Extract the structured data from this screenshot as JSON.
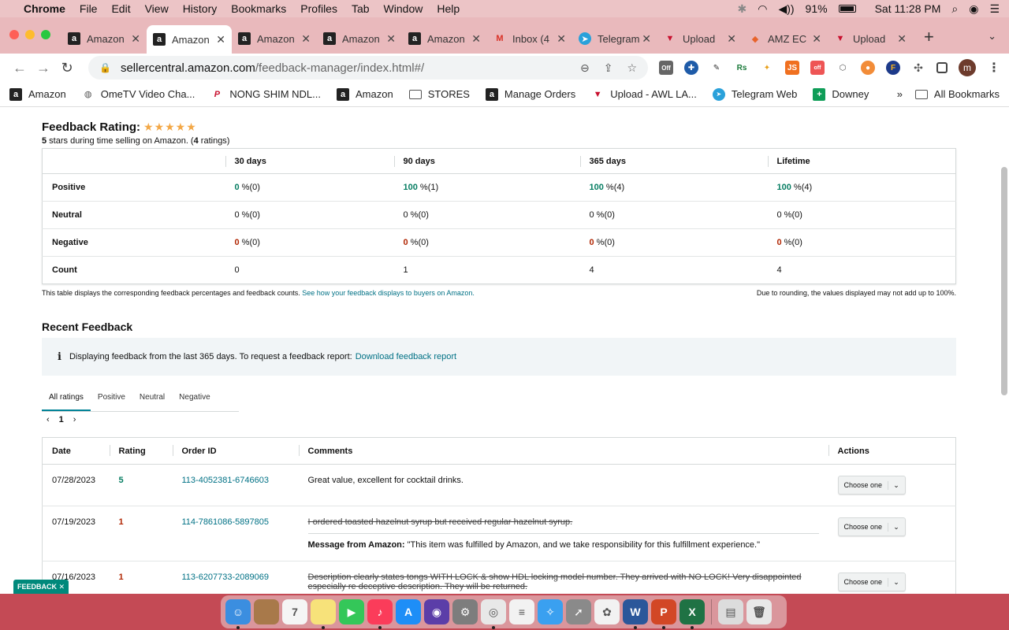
{
  "menubar": {
    "app_name": "Chrome",
    "items": [
      "File",
      "Edit",
      "View",
      "History",
      "Bookmarks",
      "Profiles",
      "Tab",
      "Window",
      "Help"
    ],
    "battery": "91%",
    "clock": "Sat 11:28 PM"
  },
  "tabs": [
    {
      "title": "Amazon",
      "icon": "amazon-icon",
      "active": false
    },
    {
      "title": "Amazon",
      "icon": "amazon-icon",
      "active": true
    },
    {
      "title": "Amazon",
      "icon": "amazon-icon",
      "active": false
    },
    {
      "title": "Amazon",
      "icon": "amazon-icon",
      "active": false
    },
    {
      "title": "Amazon",
      "icon": "amazon-icon",
      "active": false
    },
    {
      "title": "Inbox (4",
      "icon": "gmail-icon",
      "active": false
    },
    {
      "title": "Telegram",
      "icon": "telegram-icon",
      "active": false
    },
    {
      "title": "Upload",
      "icon": "upload-icon",
      "active": false
    },
    {
      "title": "AMZ EC",
      "icon": "amz-ec-icon",
      "active": false
    },
    {
      "title": "Upload",
      "icon": "upload-icon",
      "active": false
    }
  ],
  "omnibox": {
    "host": "sellercentral.amazon.com",
    "path": "/feedback-manager/index.html#/"
  },
  "extensions": {
    "off_badge": "Off",
    "rs": "Rs",
    "js": "JS",
    "off_label": "off",
    "f": "F",
    "avatar_letter": "m"
  },
  "bookmarks": [
    {
      "label": "Amazon",
      "icon": "amazon-icon"
    },
    {
      "label": "OmeTV Video Cha...",
      "icon": "globe-icon"
    },
    {
      "label": "NONG SHIM NDL...",
      "icon": "pinterest-icon"
    },
    {
      "label": "Amazon",
      "icon": "amazon-icon"
    },
    {
      "label": "STORES",
      "icon": "folder-icon"
    },
    {
      "label": "Manage Orders",
      "icon": "amazon-icon"
    },
    {
      "label": "Upload - AWL LA...",
      "icon": "upload-icon"
    },
    {
      "label": "Telegram Web",
      "icon": "telegram-icon"
    },
    {
      "label": "Downey",
      "icon": "sheets-icon"
    }
  ],
  "bookmarks_more": "»",
  "all_bookmarks": "All Bookmarks",
  "feedback_rating": {
    "title": "Feedback Rating:",
    "stars": "★★★★★",
    "stars_count": "5",
    "subtitle_mid": " stars during time selling on Amazon. (",
    "ratings_count": "4",
    "subtitle_end": " ratings)"
  },
  "metrics": {
    "headers": [
      "",
      "30 days",
      "90 days",
      "365 days",
      "Lifetime"
    ],
    "rows": [
      {
        "label": "Positive",
        "cells": [
          {
            "v": "0",
            "s": " %(0)"
          },
          {
            "v": "100",
            "s": " %(1)"
          },
          {
            "v": "100",
            "s": " %(4)"
          },
          {
            "v": "100",
            "s": " %(4)"
          }
        ],
        "cls": "pos"
      },
      {
        "label": "Neutral",
        "cells": [
          {
            "v": "0",
            "s": " %(0)"
          },
          {
            "v": "0",
            "s": " %(0)"
          },
          {
            "v": "0",
            "s": " %(0)"
          },
          {
            "v": "0",
            "s": " %(0)"
          }
        ],
        "cls": ""
      },
      {
        "label": "Negative",
        "cells": [
          {
            "v": "0",
            "s": " %(0)"
          },
          {
            "v": "0",
            "s": " %(0)"
          },
          {
            "v": "0",
            "s": " %(0)"
          },
          {
            "v": "0",
            "s": " %(0)"
          }
        ],
        "cls": "neg"
      },
      {
        "label": "Count",
        "cells": [
          {
            "v": "0",
            "s": ""
          },
          {
            "v": "1",
            "s": ""
          },
          {
            "v": "4",
            "s": ""
          },
          {
            "v": "4",
            "s": ""
          }
        ],
        "cls": ""
      }
    ],
    "note_left": "This table displays the corresponding feedback percentages and feedback counts.",
    "note_link": "See how your feedback displays to buyers on Amazon.",
    "note_right": "Due to rounding, the values displayed may not add up to 100%."
  },
  "recent": {
    "title": "Recent Feedback",
    "info_text": "Displaying feedback from the last 365 days. To request a feedback report:",
    "info_link": "Download feedback report",
    "tabs": [
      "All ratings",
      "Positive",
      "Neutral",
      "Negative"
    ],
    "page": "1",
    "headers": [
      "Date",
      "Rating",
      "Order ID",
      "Comments",
      "Actions"
    ],
    "rows": [
      {
        "date": "07/28/2023",
        "rating": "5",
        "rating_cls": "pos",
        "order": "113-4052381-6746603",
        "comment": "Great value, excellent for cocktail drinks.",
        "strike": false,
        "message_label": "",
        "message": "",
        "action": "Choose one"
      },
      {
        "date": "07/19/2023",
        "rating": "1",
        "rating_cls": "neg",
        "order": "114-7861086-5897805",
        "comment": "I ordered toasted hazelnut syrup but received regular hazelnut syrup.",
        "strike": true,
        "message_label": "Message from Amazon:",
        "message": " \"This item was fulfilled by Amazon, and we take responsibility for this fulfillment experience.\"",
        "action": "Choose one"
      },
      {
        "date": "07/16/2023",
        "rating": "1",
        "rating_cls": "neg",
        "order": "113-6207733-2089069",
        "comment": "Description clearly states tongs WITH LOCK & show HDL locking model number. They arrived with NO LOCK! Very disappointed especially re deceptive description. They will be returned.",
        "strike": true,
        "message_label": "",
        "message": "",
        "action": "Choose one"
      }
    ]
  },
  "feedback_tab": "FEEDBACK ✕",
  "dock": [
    {
      "name": "finder-icon",
      "color": "#3b8ee0",
      "glyph": "☺",
      "dot": true
    },
    {
      "name": "notes-book-icon",
      "color": "#a8794a",
      "glyph": "",
      "dot": false
    },
    {
      "name": "calendar-icon",
      "color": "#f5f5f5",
      "glyph": "7",
      "dot": false
    },
    {
      "name": "notes-icon",
      "color": "#f7e27a",
      "glyph": "",
      "dot": true
    },
    {
      "name": "facetime-icon",
      "color": "#34c759",
      "glyph": "▶",
      "dot": false
    },
    {
      "name": "music-icon",
      "color": "#fb3c5a",
      "glyph": "♪",
      "dot": true
    },
    {
      "name": "app-store-icon",
      "color": "#1e8ef7",
      "glyph": "A",
      "dot": false
    },
    {
      "name": "siri-icon",
      "color": "#5b3ea8",
      "glyph": "◉",
      "dot": false
    },
    {
      "name": "system-settings-icon",
      "color": "#7d7d7d",
      "glyph": "⚙",
      "dot": false
    },
    {
      "name": "chrome-icon",
      "color": "#e8e8e8",
      "glyph": "◎",
      "dot": true
    },
    {
      "name": "reminders-icon",
      "color": "#f2f2f2",
      "glyph": "≡",
      "dot": false
    },
    {
      "name": "safari-icon",
      "color": "#3aa0f0",
      "glyph": "✧",
      "dot": false
    },
    {
      "name": "launchpad-icon",
      "color": "#8a8a8a",
      "glyph": "➚",
      "dot": false
    },
    {
      "name": "photos-icon",
      "color": "#f2f2f2",
      "glyph": "✿",
      "dot": false
    },
    {
      "name": "word-icon",
      "color": "#2b579a",
      "glyph": "W",
      "dot": true
    },
    {
      "name": "powerpoint-icon",
      "color": "#d24726",
      "glyph": "P",
      "dot": true
    },
    {
      "name": "excel-icon",
      "color": "#1f7244",
      "glyph": "X",
      "dot": true
    },
    {
      "name": "downloads-icon",
      "color": "#dcdcdc",
      "glyph": "▤",
      "dot": false
    },
    {
      "name": "trash-icon",
      "color": "#e8e8e8",
      "glyph": "🗑",
      "dot": false
    }
  ]
}
